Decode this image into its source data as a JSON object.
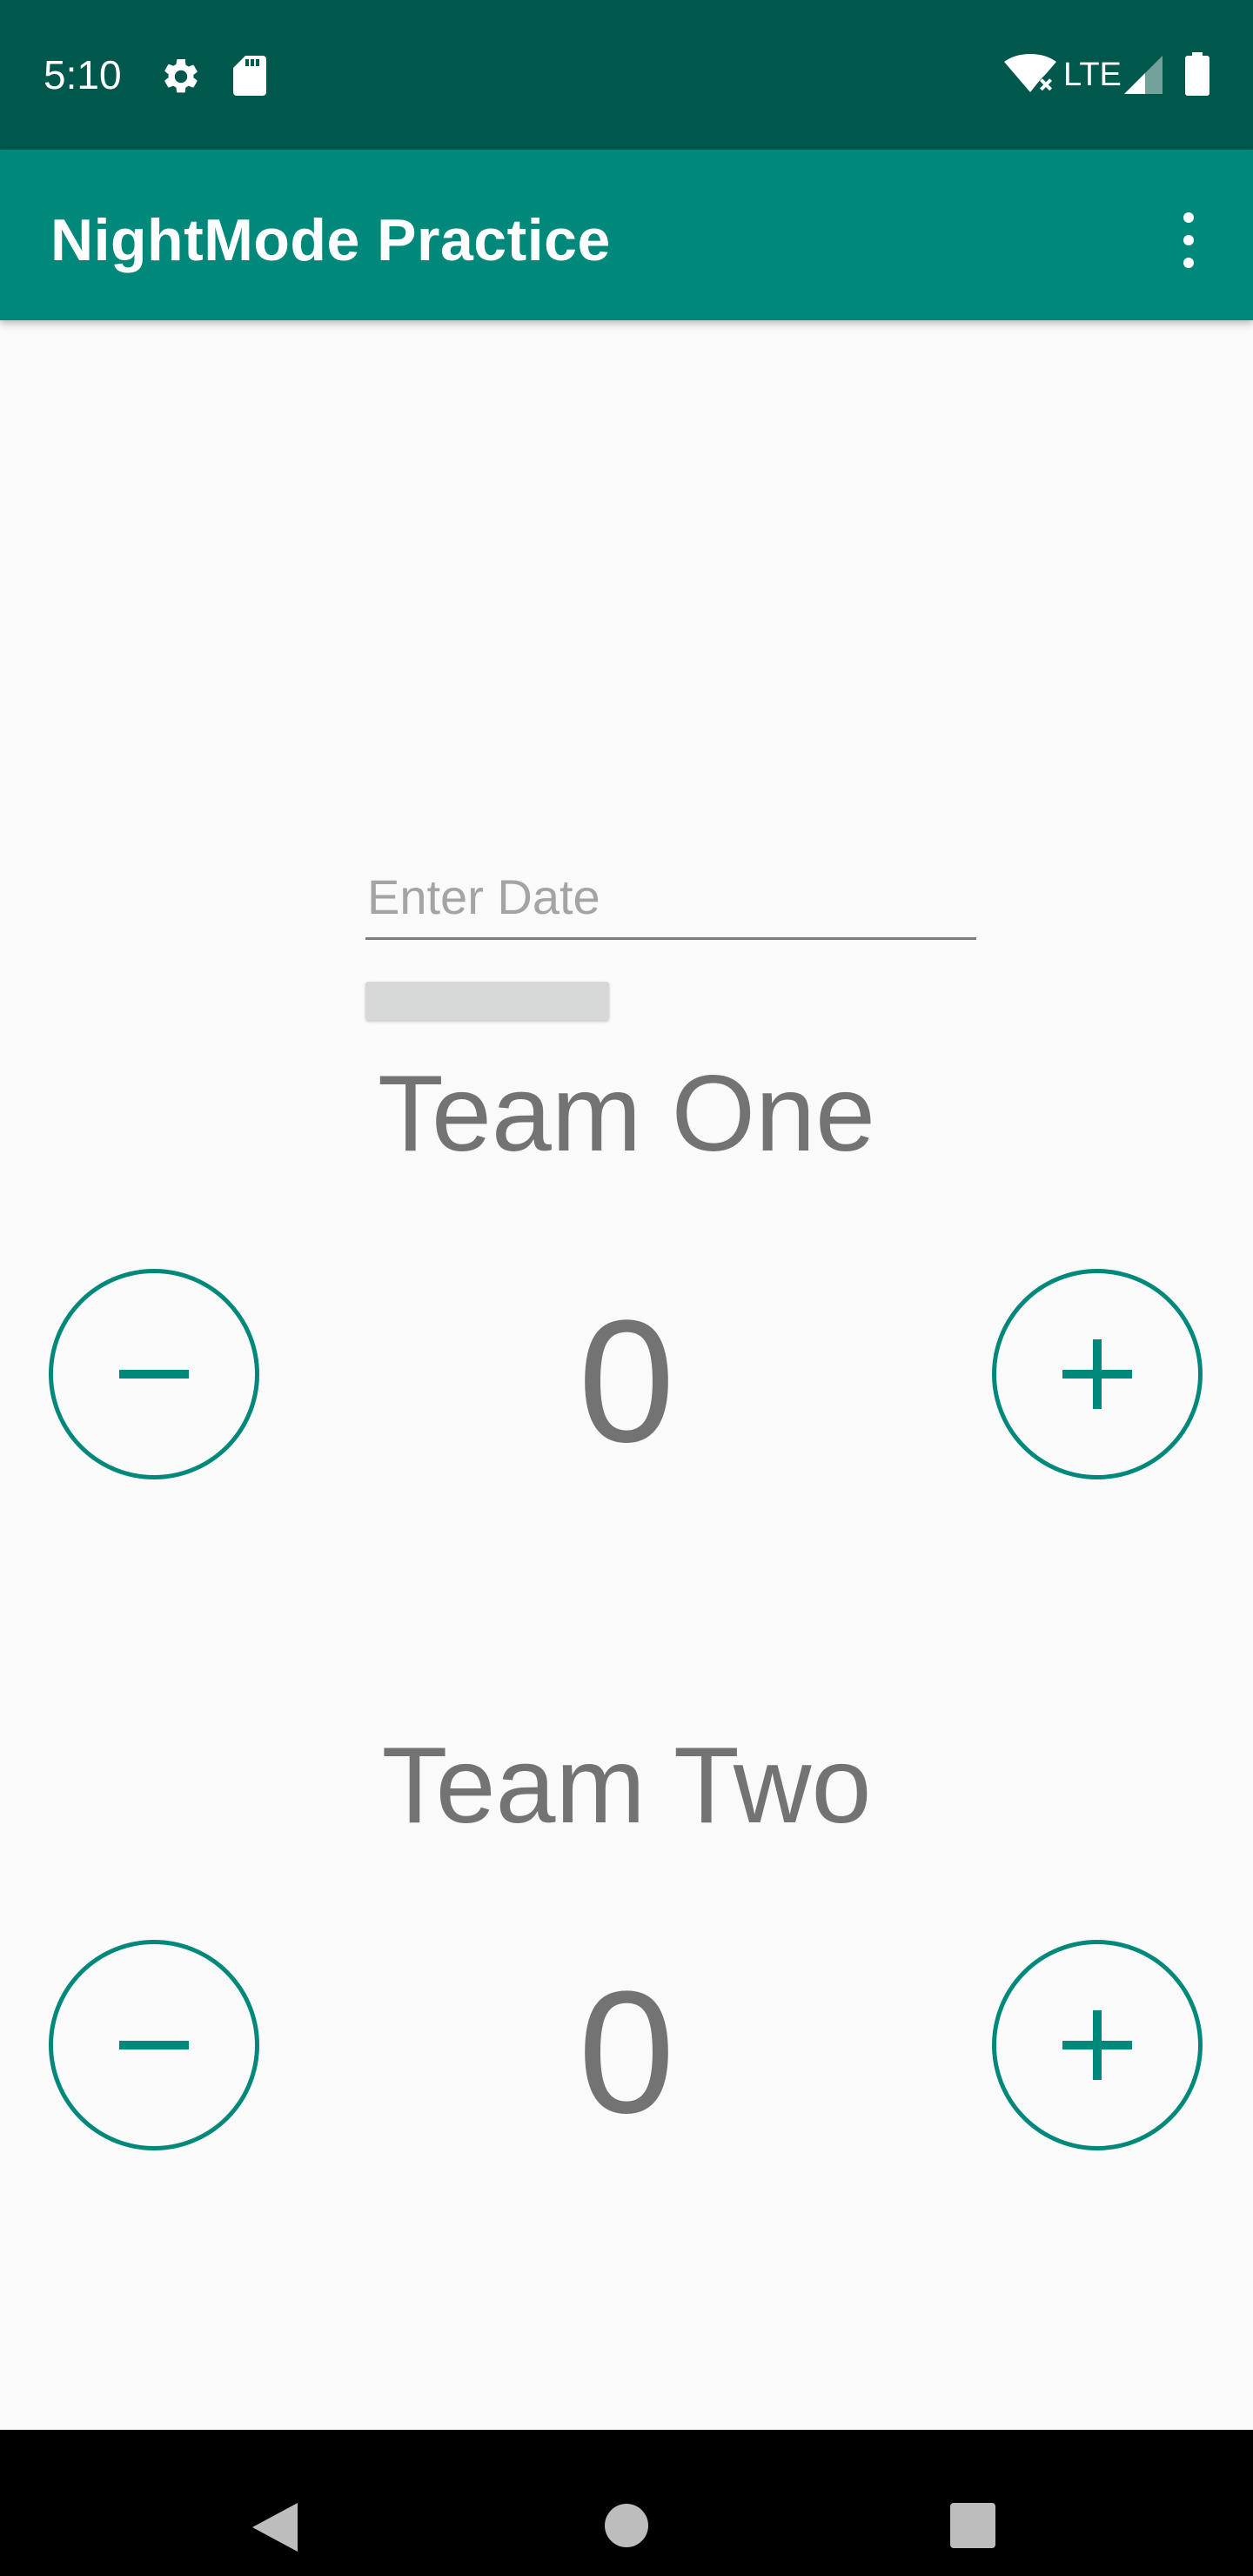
{
  "status_bar": {
    "time": "5:10",
    "network": "LTE",
    "icons": [
      "gear-icon",
      "sd-card-icon",
      "wifi-icon",
      "signal-icon",
      "battery-icon"
    ]
  },
  "app_bar": {
    "title": "NightMode Practice",
    "menu_icon": "more-vert-icon"
  },
  "date_field": {
    "placeholder": "Enter Date",
    "value": ""
  },
  "team_one": {
    "label": "Team One",
    "score": "0"
  },
  "team_two": {
    "label": "Team Two",
    "score": "0"
  },
  "nav_bar": {
    "icons": [
      "back-icon",
      "home-icon",
      "recents-icon"
    ]
  },
  "colors": {
    "status_bar": "#00574b",
    "primary": "#00897b",
    "text_gray": "#737373",
    "background": "#fafafa"
  }
}
